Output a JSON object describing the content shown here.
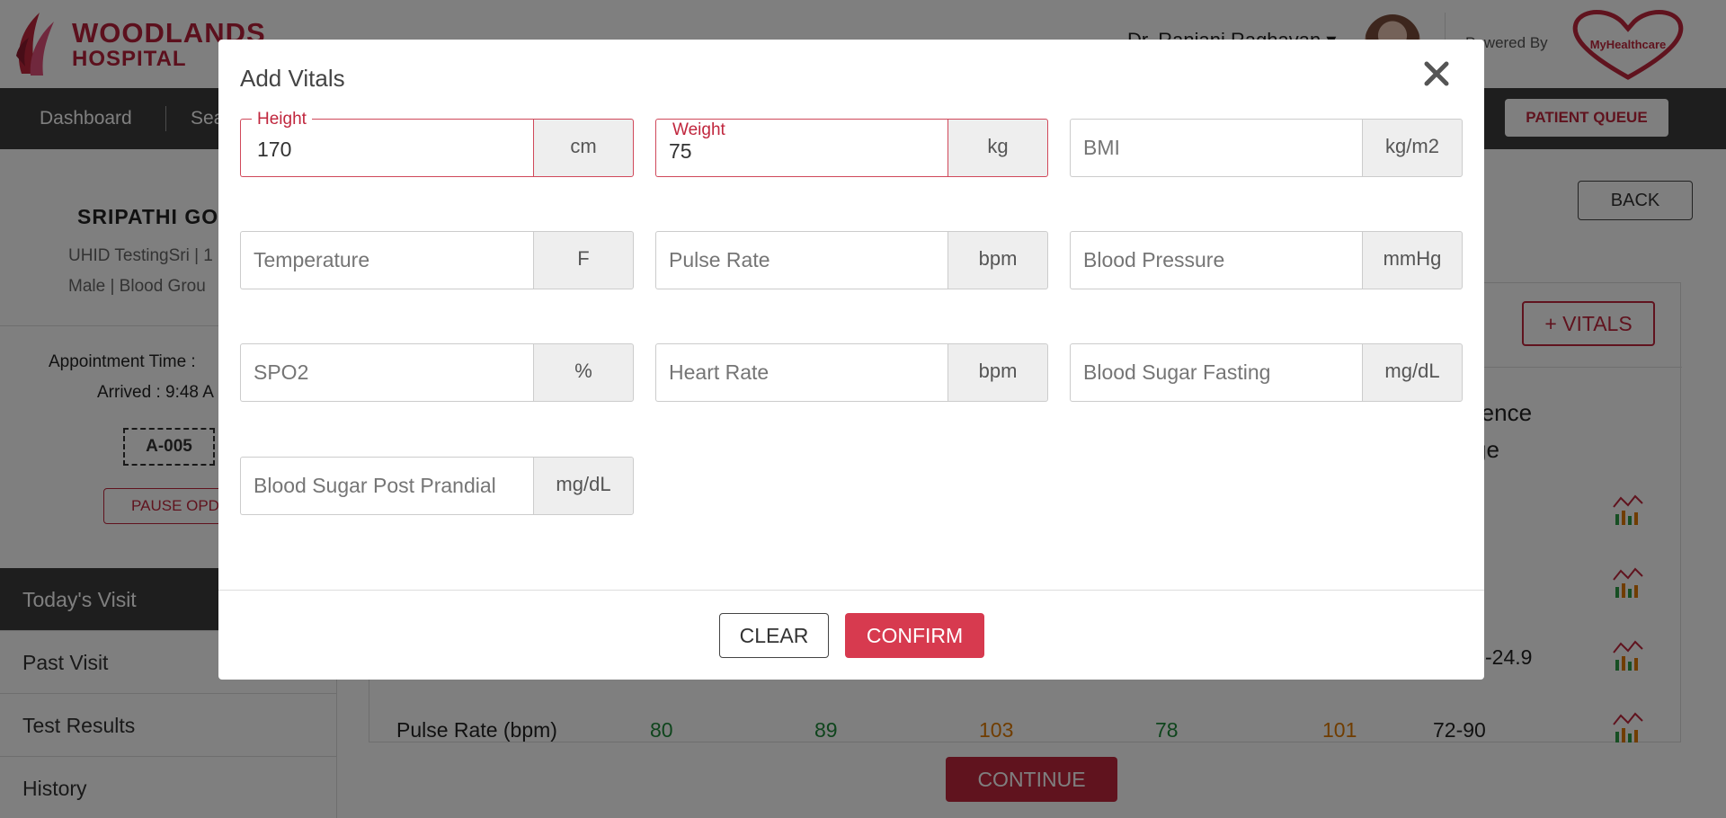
{
  "header": {
    "logo_line1": "WOODLANDS",
    "logo_line2": "HOSPITAL",
    "doctor_name": "Dr. Ranjani Raghavan",
    "powered_by": "Powered By",
    "partner_logo_text": "MyHealthcare"
  },
  "nav": {
    "items": [
      "Dashboard",
      "Sea"
    ],
    "patient_queue": "PATIENT QUEUE"
  },
  "patient": {
    "name": "SRIPATHI GO",
    "uhid": "UHID TestingSri | 1",
    "gender_blood": "Male | Blood Grou",
    "appointment_time": "Appointment Time :",
    "arrived": "Arrived : 9:48 A",
    "token": "A-005",
    "pause": "PAUSE OPD"
  },
  "sidebar": {
    "items": [
      "Today's Visit",
      "Past Visit",
      "Test Results",
      "History"
    ]
  },
  "main": {
    "back": "BACK",
    "add_vitals": "+ VITALS",
    "ref_header_1": "rence",
    "ref_header_2": "ge",
    "bmi_ref": "-24.9",
    "pulse_row": {
      "label": "Pulse Rate (bpm)",
      "values": [
        "80",
        "89",
        "103",
        "78",
        "101"
      ],
      "reference": "72-90"
    },
    "continue": "CONTINUE"
  },
  "modal": {
    "title": "Add Vitals",
    "close_symbol": "✕",
    "fields": [
      {
        "label": "Height",
        "value": "170",
        "placeholder": "",
        "unit": "cm"
      },
      {
        "label": "Weight",
        "value": "75",
        "placeholder": "",
        "unit": "kg"
      },
      {
        "label": "",
        "value": "",
        "placeholder": "BMI",
        "unit": "kg/m2"
      },
      {
        "label": "",
        "value": "",
        "placeholder": "Temperature",
        "unit": "F"
      },
      {
        "label": "",
        "value": "",
        "placeholder": "Pulse Rate",
        "unit": "bpm"
      },
      {
        "label": "",
        "value": "",
        "placeholder": "Blood Pressure",
        "unit": "mmHg"
      },
      {
        "label": "",
        "value": "",
        "placeholder": "SPO2",
        "unit": "%"
      },
      {
        "label": "",
        "value": "",
        "placeholder": "Heart Rate",
        "unit": "bpm"
      },
      {
        "label": "",
        "value": "",
        "placeholder": "Blood Sugar Fasting",
        "unit": "mg/dL"
      },
      {
        "label": "",
        "value": "",
        "placeholder": "Blood Sugar Post Prandial",
        "unit": "mg/dL"
      }
    ],
    "clear": "CLEAR",
    "confirm": "CONFIRM"
  },
  "colors": {
    "brand": "#c0263d",
    "confirm": "#d73a4f",
    "nav_bg": "#3c3c3c",
    "green": "#1f8a3a",
    "orange": "#e07b00"
  }
}
